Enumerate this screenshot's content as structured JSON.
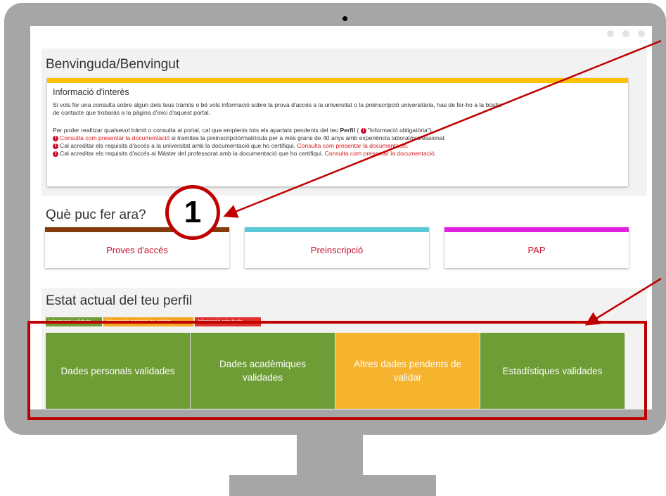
{
  "welcome": {
    "title": "Benvinguda/Benvingut"
  },
  "info": {
    "title": "Informació d'interès",
    "line1": "Si vols fer una consulta sobre algun dels teus tràmits o bé vols informació sobre la prova d'accés a la universitat o la preinscripció universitària, has de fer-ho a la bústia",
    "line2": "de contacte que trobaràs a la pàgina d'inici d'aquest portal.",
    "line3a": "Per poder realitzar qualsevol tràmit o consulta al portal, cal que emplenis tots els apartats pendents del teu ",
    "line3b": "Perfil",
    "line3c": " ( ",
    "line3d": "\"Informació obligatòria\").",
    "item1_link": "Consulta com presentar la documentació",
    "item1_text": " si tramites la preinscripció/matrícula per a més grans de 40 anys amb experiència laboral/professional.",
    "item2_text": "Cal acreditar els requisits d'accés a la universitat amb la documentació que ho certifiqui. ",
    "item2_link": "Consulta com presentar la documentació.",
    "item3_text": "Cal acreditar els requisits d'accés al Màster del professorat amb la documentació que ho certifiqui. ",
    "item3_link": "Consulta com presentar la documentació."
  },
  "actions": {
    "title": "Què puc fer ara?",
    "cards": [
      {
        "label": "Proves d'accés",
        "color": "#843c0c"
      },
      {
        "label": "Preinscripció",
        "color": "#5bc8d6"
      },
      {
        "label": "PAP",
        "color": "#e21fe0"
      }
    ]
  },
  "profile": {
    "title": "Estat actual del teu perfil",
    "legend": [
      "Informació validada",
      "Informació pendent de validar",
      "Informació rebutjada"
    ],
    "tiles": [
      {
        "label": "Dades personals validades",
        "status": "validated"
      },
      {
        "label": "Dades acadèmiques validades",
        "status": "validated"
      },
      {
        "label": "Altres dades pendents de validar",
        "status": "pending"
      },
      {
        "label": "Estadístiques validades",
        "status": "validated"
      }
    ]
  },
  "annotation": {
    "number": "1"
  },
  "colors": {
    "accent_red": "#c00000",
    "validated": "#6e9c35",
    "pending": "#f5b32e",
    "info_bar": "#ffc000"
  }
}
